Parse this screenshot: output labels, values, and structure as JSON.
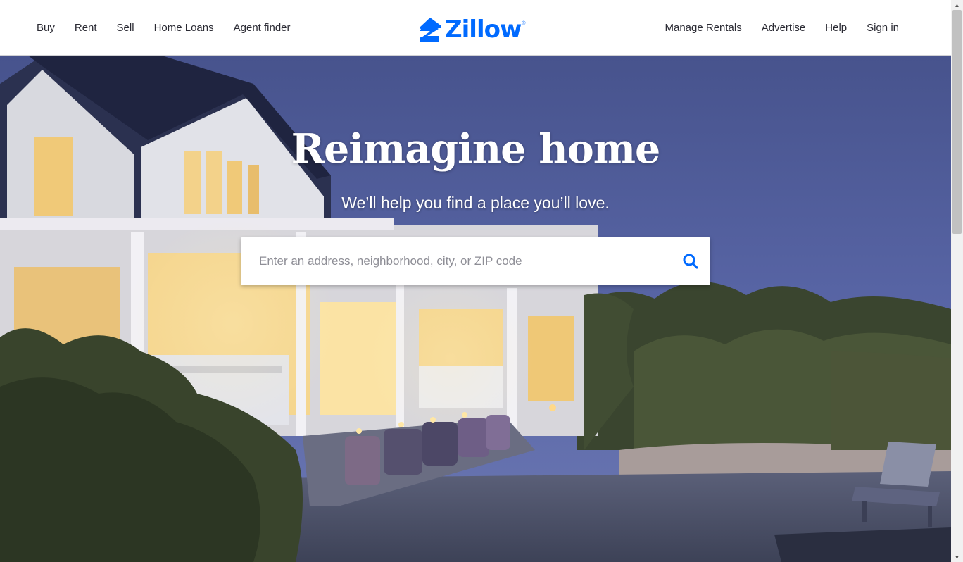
{
  "header": {
    "nav_left": [
      "Buy",
      "Rent",
      "Sell",
      "Home Loans",
      "Agent finder"
    ],
    "nav_right": [
      "Manage Rentals",
      "Advertise",
      "Help",
      "Sign in"
    ],
    "logo_text": "Zillow",
    "logo_registered": "®"
  },
  "hero": {
    "title": "Reimagine home",
    "subtitle": "We’ll help you find a place you’ll love.",
    "search": {
      "placeholder": "Enter an address, neighborhood, city, or ZIP code",
      "value": "",
      "icon": "search-icon"
    }
  },
  "colors": {
    "brand": "#006aff",
    "nav_text": "#2a2a33",
    "sky_top": "#4a5690",
    "sky_bottom": "#6775b5",
    "foliage": "#3e4a32",
    "deck": "#4c526a",
    "window_light": "#f5d68f"
  }
}
